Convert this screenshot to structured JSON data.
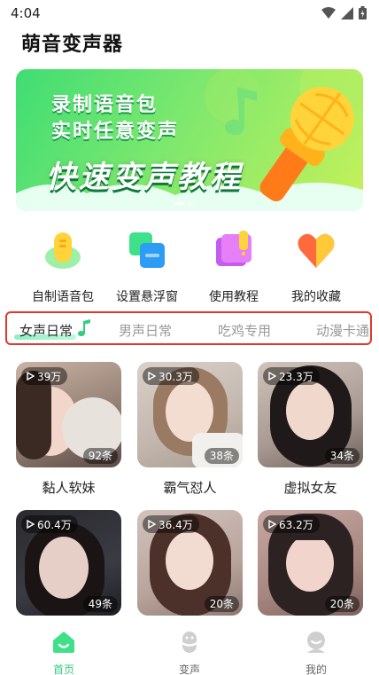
{
  "status_bar": {
    "time": "4:04"
  },
  "app": {
    "title": "萌音变声器"
  },
  "banner": {
    "line1": "录制语音包",
    "line2": "实时任意变声",
    "headline": "快速变声教程"
  },
  "features": [
    {
      "label": "自制语音包",
      "icon": "yellow-mic-icon"
    },
    {
      "label": "设置悬浮窗",
      "icon": "floating-window-icon"
    },
    {
      "label": "使用教程",
      "icon": "tutorial-book-icon"
    },
    {
      "label": "我的收藏",
      "icon": "heart-icon"
    }
  ],
  "tabs": [
    {
      "label": "女声日常",
      "active": true
    },
    {
      "label": "男声日常",
      "active": false
    },
    {
      "label": "吃鸡专用",
      "active": false
    },
    {
      "label": "动漫卡通",
      "active": false
    }
  ],
  "cards": [
    {
      "plays": "39万",
      "count": "92条",
      "name": "黏人软妹"
    },
    {
      "plays": "30.3万",
      "count": "38条",
      "name": "霸气怼人"
    },
    {
      "plays": "23.3万",
      "count": "34条",
      "name": "虚拟女友"
    },
    {
      "plays": "60.4万",
      "count": "49条",
      "name": ""
    },
    {
      "plays": "36.4万",
      "count": "20条",
      "name": ""
    },
    {
      "plays": "63.2万",
      "count": "20条",
      "name": ""
    }
  ],
  "bottom_nav": [
    {
      "label": "首页",
      "active": true
    },
    {
      "label": "变声",
      "active": false
    },
    {
      "label": "我的",
      "active": false
    }
  ],
  "colors": {
    "accent": "#2fd07f",
    "highlight_border": "#e0392c"
  }
}
